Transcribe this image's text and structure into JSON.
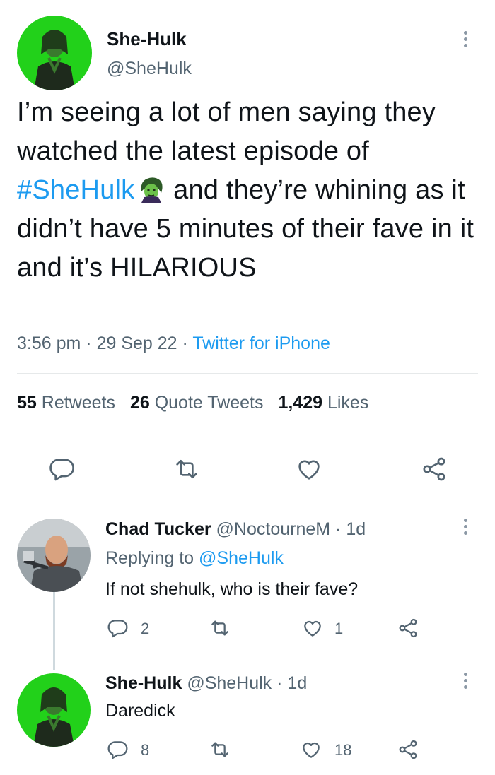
{
  "tweet": {
    "display_name": "She-Hulk",
    "handle": "@SheHulk",
    "text_before": "I’m seeing a lot of men saying they watched the latest episode of ",
    "hashtag": "#SheHulk",
    "emoji_icon": "she-hulk-emoji-icon",
    "text_after": " and they’re whining as it didn’t have 5 minutes of their fave in it and it’s HILARIOUS",
    "time": "3:56 pm",
    "date": "29 Sep 22",
    "source": "Twitter for iPhone",
    "sep": "·",
    "retweets_count": "55",
    "retweets_label": "Retweets",
    "quotes_count": "26",
    "quotes_label": "Quote Tweets",
    "likes_count": "1,429",
    "likes_label": "Likes"
  },
  "replies": [
    {
      "display_name": "Chad Tucker",
      "handle": "@NoctourneM",
      "age": "· 1d",
      "replying_label": "Replying to",
      "replying_to": "@SheHulk",
      "text": "If not shehulk, who is their fave?",
      "reply_count": "2",
      "retweet_count": "",
      "like_count": "1"
    },
    {
      "display_name": "She-Hulk",
      "handle": "@SheHulk",
      "age": "· 1d",
      "text": "Daredick",
      "reply_count": "8",
      "retweet_count": "",
      "like_count": "18"
    }
  ],
  "colors": {
    "accent": "#1d9bf0",
    "avatar_green": "#22d11a",
    "text": "#0f1419",
    "muted": "#536471"
  }
}
